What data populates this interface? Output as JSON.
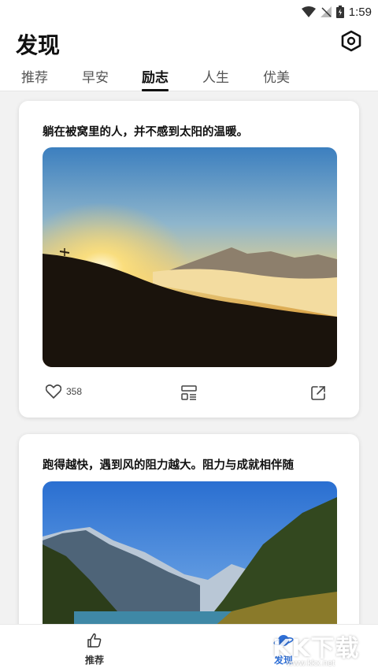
{
  "status_bar": {
    "time": "1:59"
  },
  "header": {
    "title": "发现",
    "settings_icon": "settings-hex-icon",
    "tabs": [
      {
        "label": "推荐",
        "active": false
      },
      {
        "label": "早安",
        "active": false
      },
      {
        "label": "励志",
        "active": true
      },
      {
        "label": "人生",
        "active": false
      },
      {
        "label": "优美",
        "active": false
      }
    ]
  },
  "cards": [
    {
      "quote": "躺在被窝里的人，并不感到太阳的温暖。",
      "image": "sunset-over-clouds-photo",
      "likes": "358"
    },
    {
      "quote": "跑得越快，遇到风的阻力越大。阻力与成就相伴随",
      "image": "mountain-lake-photo"
    }
  ],
  "bottom_nav": {
    "items": [
      {
        "label": "推荐",
        "icon": "thumbs-up-icon",
        "active": false
      },
      {
        "label": "发现",
        "icon": "planet-icon",
        "active": true
      }
    ]
  },
  "watermark": {
    "text": "KK下载",
    "url": "www.kkx.net"
  },
  "colors": {
    "accent": "#2f6fd6",
    "text": "#111111",
    "background": "#f2f2f2"
  }
}
